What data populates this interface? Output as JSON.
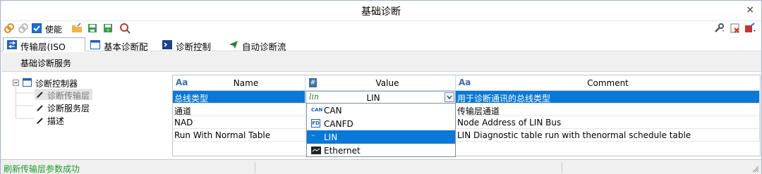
{
  "window": {
    "title": "基础诊断",
    "close_glyph": "×"
  },
  "toolbar": {
    "enable_label": "使能"
  },
  "tabs": [
    {
      "label": "传输层(ISO TP)"
    },
    {
      "label": "基本诊断配置"
    },
    {
      "label": "诊断控制台"
    },
    {
      "label": "自动诊断流程"
    }
  ],
  "section": {
    "title": "基础诊断服务"
  },
  "tree": {
    "root": "诊断控制器",
    "children": [
      "诊断传输层",
      "诊断服务层",
      "描述"
    ]
  },
  "grid": {
    "type_glyph": "Aa",
    "index_glyph": "#",
    "columns": [
      "Name",
      "Value",
      "Comment"
    ],
    "rows": [
      {
        "name": "总线类型",
        "value": "LIN",
        "value_icon": "lin",
        "comment": "用于诊断通讯的总线类型"
      },
      {
        "name": "通道",
        "value": "",
        "comment": "传输层通道"
      },
      {
        "name": "NAD",
        "value": "",
        "comment": "Node Address of LIN Bus"
      },
      {
        "name": "Run With Normal Table",
        "value": "",
        "comment": "LIN Diagnostic table run with thenormal schedule table"
      }
    ]
  },
  "dropdown": {
    "options": [
      {
        "label": "CAN",
        "icon": "CAN"
      },
      {
        "label": "CANFD",
        "icon": "FD"
      },
      {
        "label": "LIN",
        "icon": "lin"
      },
      {
        "label": "Ethernet",
        "icon": "eth"
      }
    ],
    "selected": "LIN"
  },
  "status": {
    "message": "刷新传输层参数成功"
  },
  "colors": {
    "accent": "#0a78d7",
    "status_text": "#1e9a2f"
  }
}
